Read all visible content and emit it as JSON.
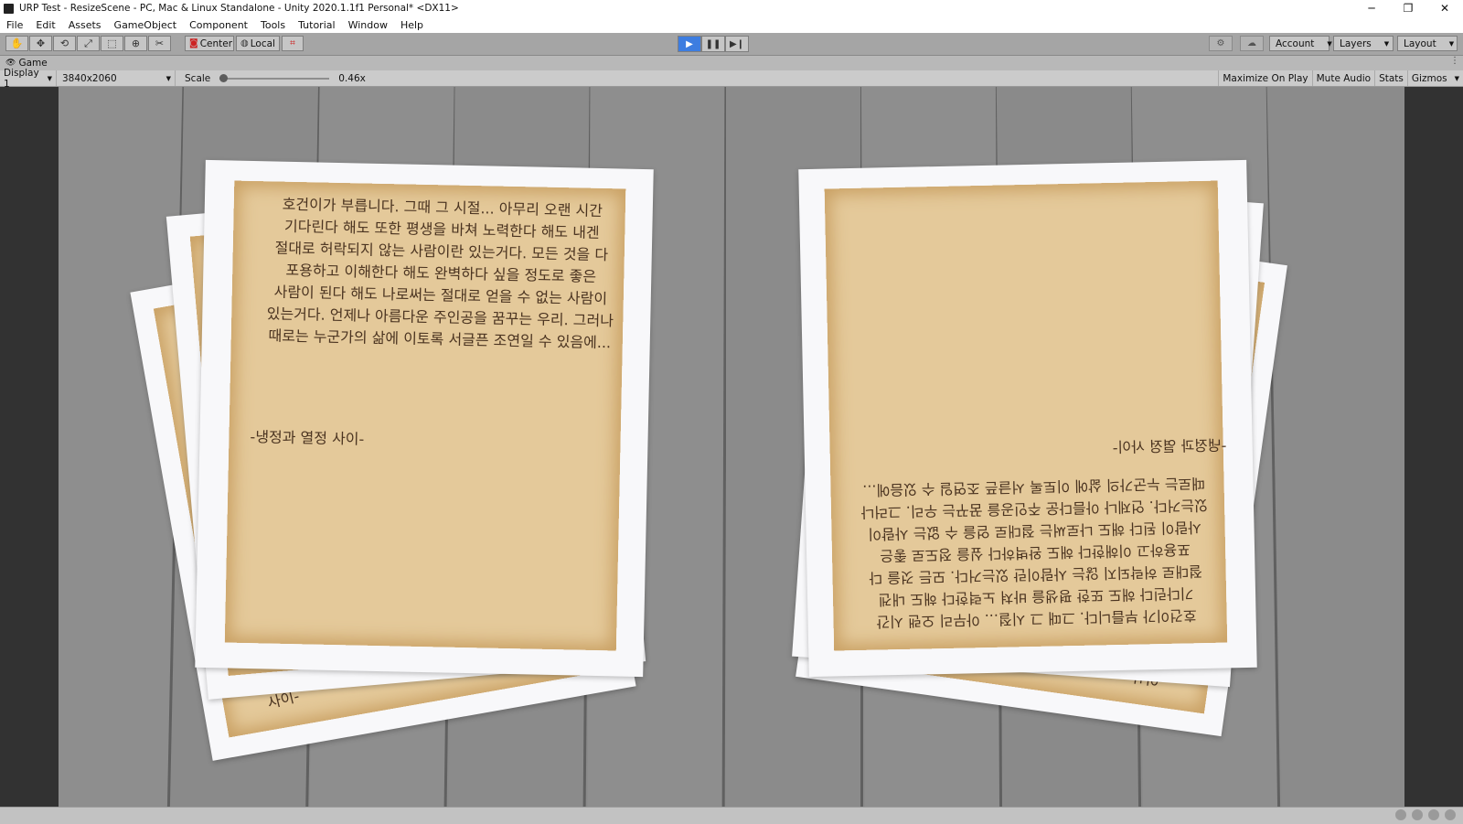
{
  "window": {
    "title": "URP Test - ResizeScene - PC, Mac & Linux Standalone - Unity 2020.1.1f1 Personal* <DX11>",
    "controls": {
      "minimize": "─",
      "maximize": "❐",
      "close": "✕"
    }
  },
  "menu": [
    "File",
    "Edit",
    "Assets",
    "GameObject",
    "Component",
    "Tools",
    "Tutorial",
    "Window",
    "Help"
  ],
  "toolbar": {
    "tools": [
      "hand-tool",
      "move-tool",
      "rotate-tool",
      "scale-tool",
      "rect-tool",
      "transform-tool",
      "custom-tool"
    ],
    "pivot_label": "Center",
    "space_label": "Local",
    "account_label": "Account",
    "layers_label": "Layers",
    "layout_label": "Layout"
  },
  "game_view": {
    "tab_label": "Game",
    "display": "Display 1",
    "resolution": "3840x2060",
    "scale_label": "Scale",
    "scale_value": "0.46x",
    "maximize_on_play": "Maximize On Play",
    "mute_audio": "Mute Audio",
    "stats": "Stats",
    "gizmos": "Gizmos"
  },
  "scene": {
    "left_letter_lines": [
      "호건이가 부릅니다. 그때 그 시절... 아무리 오랜 시간",
      "기다린다 해도 또한 평생을 바쳐 노력한다 해도 내겐",
      "절대로 허락되지 않는 사람이란 있는거다. 모든 것을 다",
      "포용하고 이해한다 해도 완벽하다 싶을 정도로 좋은",
      "사람이 된다 해도 나로써는 절대로 얻을 수 없는 사람이",
      "있는거다. 언제나 아름다운 주인공을 꿈꾸는 우리. 그러나",
      "때로는 누군가의 삶에 이토록 서글픈 조연일 수 있음에..."
    ],
    "left_letter_signature": "-냉정과 열정 사이-",
    "back_left_fragment": "사이-",
    "back_right_fragment": "-이사"
  },
  "colors": {
    "play_active": "#3d7de0",
    "parchment": "#e4c99a",
    "ink": "#4a3320",
    "wood": "#8e8e8e"
  }
}
